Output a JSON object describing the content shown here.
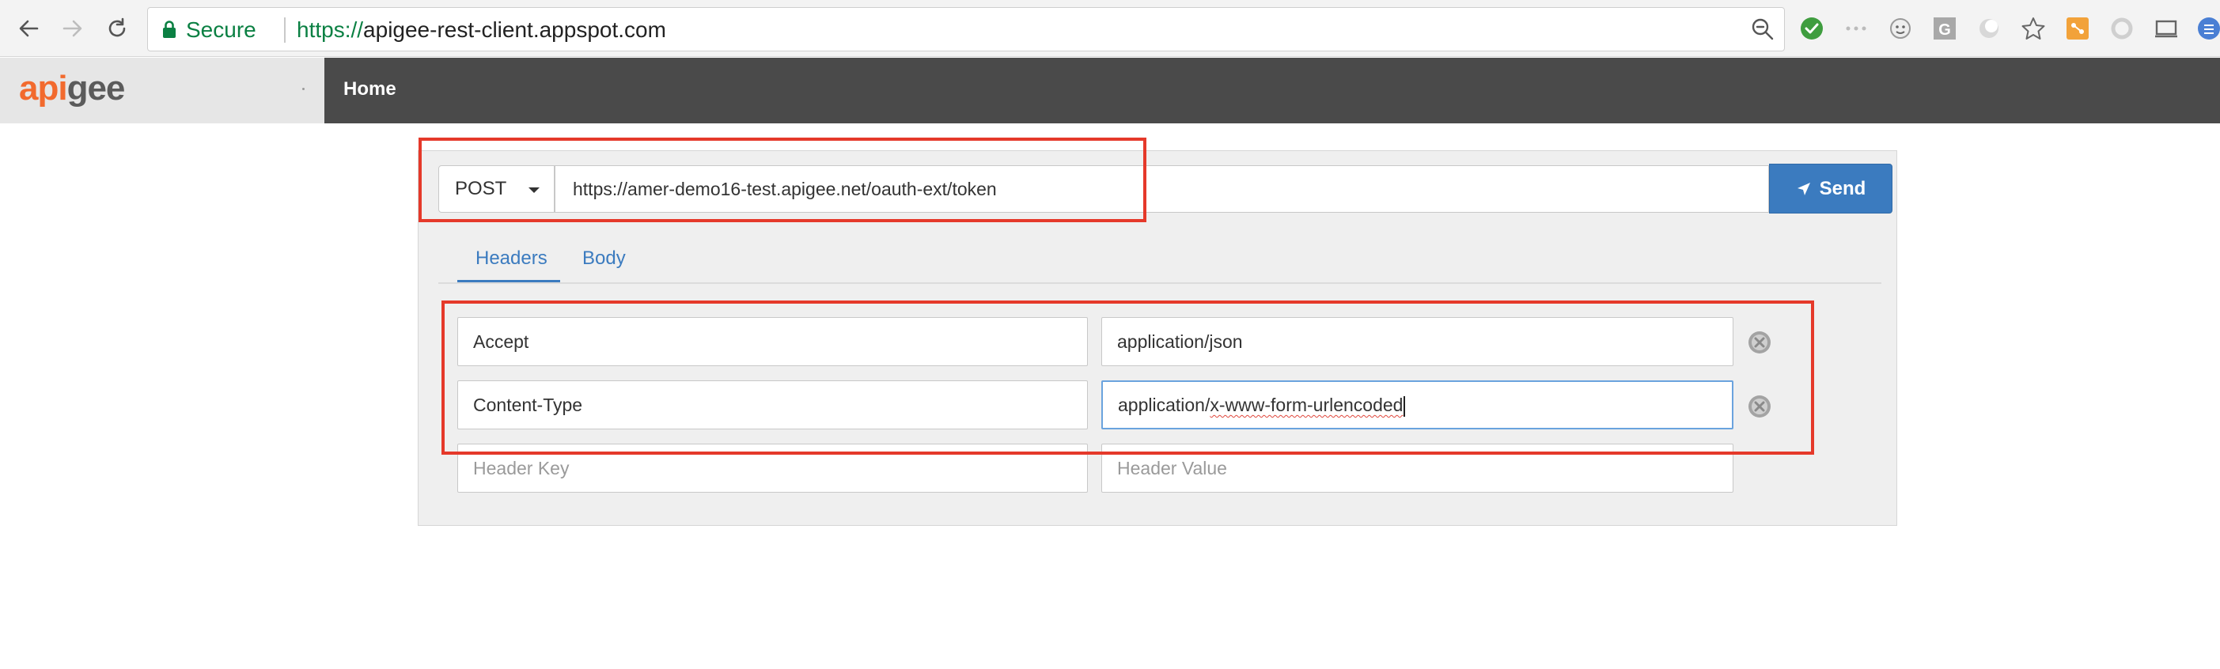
{
  "browser": {
    "security_label": "Secure",
    "url_scheme": "https://",
    "url_host": "apigee-rest-client.appspot.com",
    "icons": [
      "back-arrow-icon",
      "forward-arrow-icon",
      "reload-icon",
      "lock-icon",
      "zoom-icon",
      "check-extension-icon",
      "dots-extension-icon",
      "face-extension-icon",
      "g-extension-icon",
      "circle-extension-icon",
      "star-icon",
      "orange-extension-icon",
      "ring-extension-icon",
      "cast-icon",
      "shield-extension-icon"
    ]
  },
  "app": {
    "logo_part1": "api",
    "logo_part2": "gee",
    "nav_home": "Home"
  },
  "request": {
    "method": "POST",
    "url": "https://amer-demo16-test.apigee.net/oauth-ext/token",
    "send_label": "Send"
  },
  "tabs": [
    {
      "label": "Headers",
      "active": true
    },
    {
      "label": "Body",
      "active": false
    }
  ],
  "headers": [
    {
      "key": "Accept",
      "value": "application/json"
    },
    {
      "key": "Content-Type",
      "value_prefix": "application/",
      "value_misspelled": "x-www-form-urlencoded"
    }
  ],
  "new_header": {
    "key_placeholder": "Header Key",
    "value_placeholder": "Header Value"
  },
  "colors": {
    "accent": "#3b7bbf",
    "highlight": "#e5392a",
    "logo_orange": "#f26a2e",
    "navbar": "#4a4a4a"
  }
}
